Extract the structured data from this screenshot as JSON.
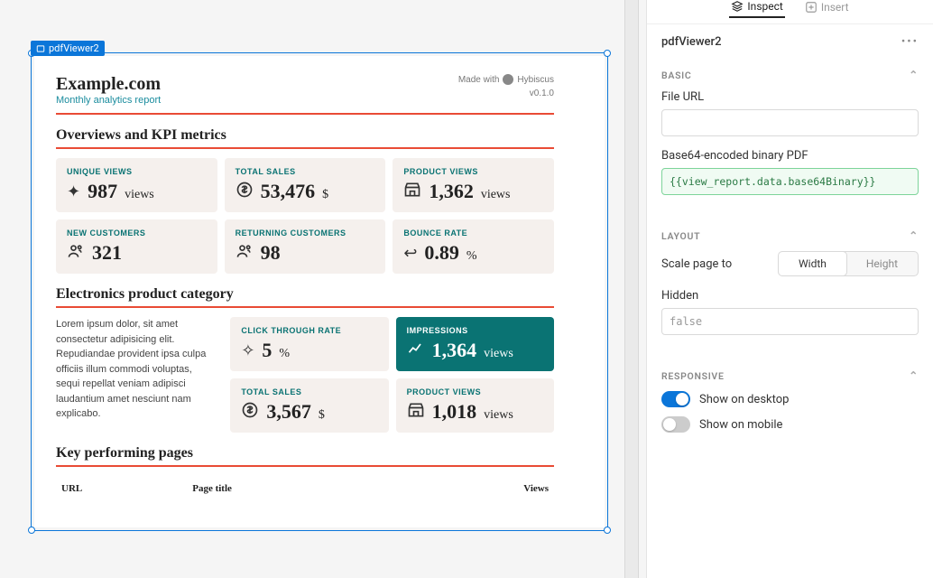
{
  "inspector": {
    "tabs": {
      "inspect": "Inspect",
      "insert": "Insert"
    },
    "component_name": "pdfViewer2",
    "basic": {
      "header": "Basic",
      "file_url_label": "File URL",
      "file_url_value": "",
      "base64_label": "Base64-encoded binary PDF",
      "base64_value": "{{view_report.data.base64Binary}}"
    },
    "layout": {
      "header": "Layout",
      "scale_label": "Scale page to",
      "scale_options": {
        "width": "Width",
        "height": "Height"
      },
      "hidden_label": "Hidden",
      "hidden_value": "false"
    },
    "responsive": {
      "header": "Responsive",
      "show_desktop": "Show on desktop",
      "show_mobile": "Show on mobile"
    }
  },
  "selection_label": "pdfViewer2",
  "pdf": {
    "title": "Example.com",
    "subtitle": "Monthly analytics report",
    "made_with": "Made with",
    "brand": "Hybiscus",
    "version": "v0.1.0",
    "section1_title": "Overviews and KPI metrics",
    "kpi": {
      "unique_views": {
        "label": "UNIQUE VIEWS",
        "value": "987",
        "unit": "views"
      },
      "total_sales": {
        "label": "TOTAL SALES",
        "value": "53,476",
        "unit": "$"
      },
      "product_views": {
        "label": "PRODUCT VIEWS",
        "value": "1,362",
        "unit": "views"
      },
      "new_customers": {
        "label": "NEW CUSTOMERS",
        "value": "321",
        "unit": ""
      },
      "returning": {
        "label": "RETURNING CUSTOMERS",
        "value": "98",
        "unit": ""
      },
      "bounce": {
        "label": "BOUNCE RATE",
        "value": "0.89",
        "unit": "%"
      }
    },
    "section2_title": "Electronics product category",
    "body_text": "Lorem ipsum dolor, sit amet consectetur adipisicing elit. Repudiandae provident ipsa culpa officiis illum commodi voluptas, sequi repellat veniam adipisci laudantium amet nesciunt nam explicabo.",
    "metrics2": {
      "ctr": {
        "label": "CLICK THROUGH RATE",
        "value": "5",
        "unit": "%"
      },
      "impressions": {
        "label": "IMPRESSIONS",
        "value": "1,364",
        "unit": "views"
      },
      "total_sales": {
        "label": "TOTAL SALES",
        "value": "3,567",
        "unit": "$"
      },
      "product_views": {
        "label": "PRODUCT VIEWS",
        "value": "1,018",
        "unit": "views"
      }
    },
    "section3_title": "Key performing pages",
    "table": {
      "url": "URL",
      "page_title": "Page title",
      "views": "Views"
    }
  }
}
